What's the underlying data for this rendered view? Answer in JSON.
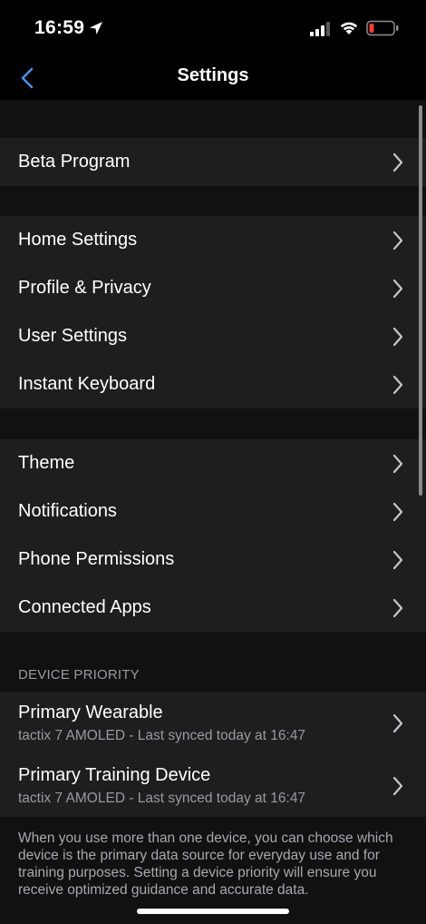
{
  "status_bar": {
    "time": "16:59",
    "icons": [
      "location-arrow-icon",
      "cellular-signal-icon",
      "wifi-icon",
      "battery-low-icon"
    ],
    "battery_color": "#ff3b30"
  },
  "nav": {
    "title": "Settings",
    "back_icon": "chevron-left-icon",
    "accent": "#4a90e2"
  },
  "groups": {
    "beta": [
      "Beta Program"
    ],
    "general": [
      "Home Settings",
      "Profile & Privacy",
      "User Settings",
      "Instant Keyboard"
    ],
    "appearance": [
      "Theme",
      "Notifications",
      "Phone Permissions",
      "Connected Apps"
    ]
  },
  "device_priority": {
    "header": "DEVICE PRIORITY",
    "items": [
      {
        "title": "Primary Wearable",
        "subtitle": "tactix 7 AMOLED - Last synced today at 16:47"
      },
      {
        "title": "Primary Training Device",
        "subtitle": "tactix 7 AMOLED - Last synced today at 16:47"
      }
    ],
    "footer": "When you use more than one device, you can choose which device is the primary data source for everyday use and for training purposes. Setting a device priority will ensure you receive optimized guidance and accurate data."
  },
  "colors": {
    "background": "#111112",
    "row_background": "#1e1e1f",
    "secondary_text": "#9a9a9e"
  }
}
